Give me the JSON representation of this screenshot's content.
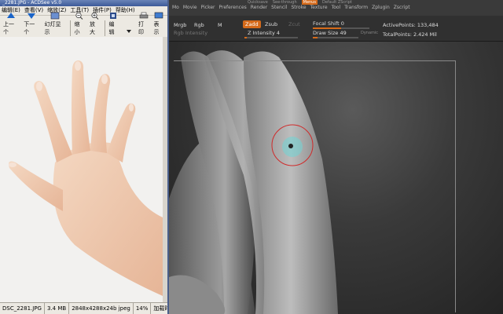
{
  "acdsee": {
    "title": "_2281.JPG - ACDSee v5.0",
    "menus": [
      "编辑(E)",
      "查看(V)",
      "缩放(Z)",
      "工具(T)",
      "插件(P)",
      "帮助(H)"
    ],
    "toolbar": [
      "上一个",
      "下一个",
      "幻灯显示",
      "缩小",
      "放大",
      "编辑",
      "打印",
      "表示"
    ],
    "status": {
      "file": "DSC_2281.JPG",
      "size": "3.4 MB",
      "dims": "2848x4288x24b jpeg",
      "zoom": "14%",
      "time": "加载时间"
    }
  },
  "zbrush": {
    "top_tabs": [
      "Quicksave",
      "See-through",
      "Menus",
      "Default ZScript"
    ],
    "menu": [
      "Mo",
      "Movie",
      "Picker",
      "Preferences",
      "Render",
      "Stencil",
      "Stroke",
      "Texture",
      "Tool",
      "Transform",
      "Zplugin",
      "Zscript"
    ],
    "buttons": {
      "mrgb": "Mrgb",
      "rgb": "Rgb",
      "m": "M",
      "zadd": "Zadd",
      "zsub": "Zsub",
      "zcut": "Zcut",
      "rgb_intensity": "Rgb Intensity",
      "z_intensity": "Z Intensity 4",
      "focal_shift": "Focal Shift 0",
      "draw_size": "Draw Size 49",
      "dynamic": "Dynamic",
      "active_points": "ActivePoints: 133,484",
      "total_points": "TotalPoints: 2.424 Mil"
    },
    "sliders": {
      "z_intensity": 0.04,
      "focal_shift": 0.5,
      "draw_size": 0.1
    },
    "accent": "#d56a1a",
    "brush_ring_color": "#d02a2a",
    "brush_center_color": "#6fd6d6"
  }
}
